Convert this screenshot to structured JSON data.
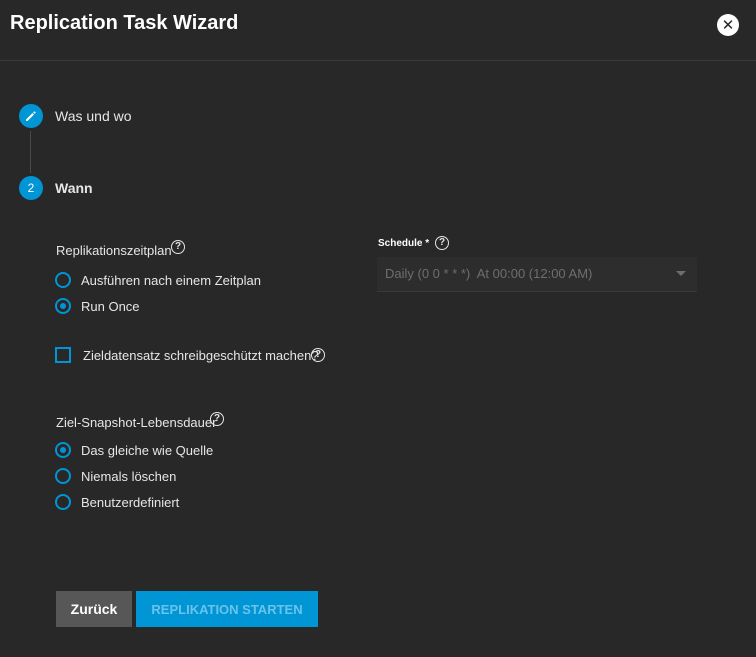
{
  "header": {
    "title": "Replication Task Wizard",
    "close_icon": "close-icon"
  },
  "steps": [
    {
      "icon": "pencil-icon",
      "label": "Was und wo"
    },
    {
      "number": "2",
      "label": "Wann"
    }
  ],
  "schedule_type": {
    "label": "Replikationszeitplan",
    "options": [
      {
        "label": "Ausführen nach einem Zeitplan",
        "checked": false
      },
      {
        "label": "Run Once",
        "checked": true
      }
    ]
  },
  "schedule": {
    "label": "Schedule *",
    "value": "Daily (0 0 * * *)  At 00:00 (12:00 AM)"
  },
  "readonly_checkbox": {
    "label": "Zieldatensatz schreibgeschützt machen?",
    "checked": false
  },
  "lifetime": {
    "label": "Ziel-Snapshot-Lebensdauer",
    "options": [
      {
        "label": "Das gleiche wie Quelle",
        "checked": true
      },
      {
        "label": "Niemals löschen",
        "checked": false
      },
      {
        "label": "Benutzerdefiniert",
        "checked": false
      }
    ]
  },
  "help_glyph": "?",
  "buttons": {
    "back": "Zurück",
    "start": "REPLIKATION STARTEN"
  },
  "colors": {
    "background": "#282828",
    "accent": "#0095d5",
    "button_secondary": "#575757"
  }
}
